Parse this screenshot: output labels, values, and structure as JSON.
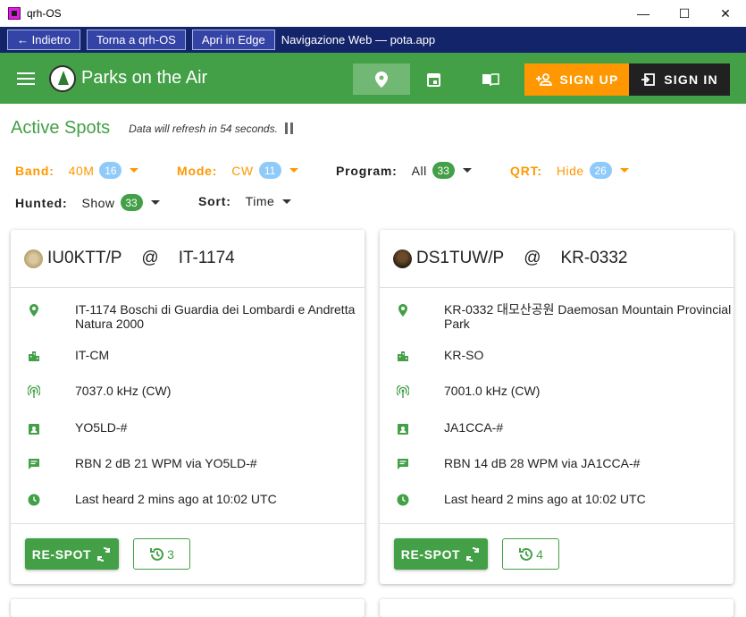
{
  "window": {
    "title": "qrh-OS",
    "minimize": "—",
    "maximize": "☐",
    "close": "✕"
  },
  "nav": {
    "back": "← Indietro",
    "home": "Torna a qrh-OS",
    "edge": "Apri in Edge",
    "title": "Navigazione Web — pota.app"
  },
  "appbar": {
    "brand": "Parks on the Air",
    "signup": "SIGN UP",
    "signin": "SIGN IN"
  },
  "heading": {
    "title": "Active Spots",
    "refresh": "Data will refresh in 54 seconds."
  },
  "filters": {
    "band": {
      "label": "Band:",
      "value": "40M",
      "count": "16"
    },
    "mode": {
      "label": "Mode:",
      "value": "CW",
      "count": "11"
    },
    "program": {
      "label": "Program:",
      "value": "All",
      "count": "33"
    },
    "qrt": {
      "label": "QRT:",
      "value": "Hide",
      "count": "26"
    },
    "hunted": {
      "label": "Hunted:",
      "value": "Show",
      "count": "33"
    },
    "sort": {
      "label": "Sort:",
      "value": "Time"
    }
  },
  "colors": {
    "green": "#43a047",
    "orange": "#ff9800",
    "dark": "#212121",
    "nav": "#14246b"
  },
  "spots": [
    {
      "callsign": "IU0KTT/P",
      "at": "@",
      "park": "IT-1174",
      "park_name": "IT-1174  Boschi di Guardia dei Lombardi e Andretta Natura 2000",
      "location": "IT-CM",
      "frequency": "7037.0 kHz (CW)",
      "spotter": "YO5LD-#",
      "comment": "RBN 2 dB 21 WPM via YO5LD-#",
      "heard": "Last heard 2 mins ago at 10:02 UTC",
      "respot": "RE-SPOT",
      "history_count": "3"
    },
    {
      "callsign": "DS1TUW/P",
      "at": "@",
      "park": "KR-0332",
      "park_name": "KR-0332  대모산공원 Daemosan Mountain Provincial Park",
      "location": "KR-SO",
      "frequency": "7001.0 kHz (CW)",
      "spotter": "JA1CCA-#",
      "comment": "RBN 14 dB 28 WPM via JA1CCA-#",
      "heard": "Last heard 2 mins ago at 10:02 UTC",
      "respot": "RE-SPOT",
      "history_count": "4"
    }
  ]
}
